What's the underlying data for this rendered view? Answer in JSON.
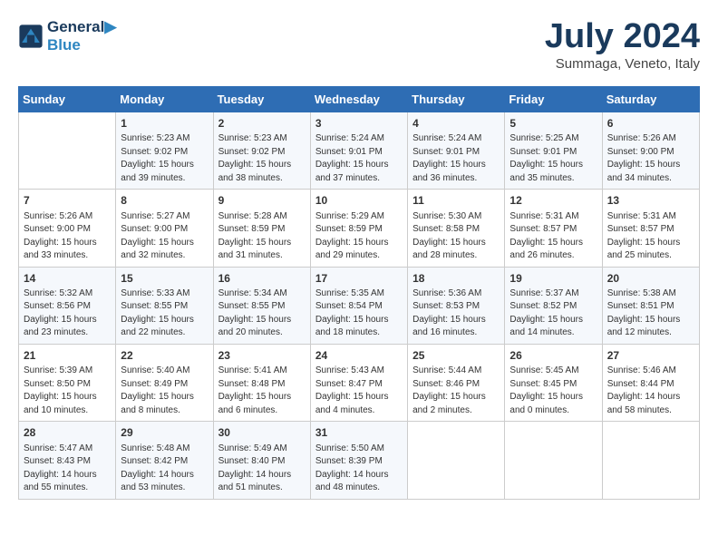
{
  "logo": {
    "line1": "General",
    "line2": "Blue"
  },
  "title": "July 2024",
  "subtitle": "Summaga, Veneto, Italy",
  "headers": [
    "Sunday",
    "Monday",
    "Tuesday",
    "Wednesday",
    "Thursday",
    "Friday",
    "Saturday"
  ],
  "rows": [
    [
      {
        "day": "",
        "info": ""
      },
      {
        "day": "1",
        "info": "Sunrise: 5:23 AM\nSunset: 9:02 PM\nDaylight: 15 hours\nand 39 minutes."
      },
      {
        "day": "2",
        "info": "Sunrise: 5:23 AM\nSunset: 9:02 PM\nDaylight: 15 hours\nand 38 minutes."
      },
      {
        "day": "3",
        "info": "Sunrise: 5:24 AM\nSunset: 9:01 PM\nDaylight: 15 hours\nand 37 minutes."
      },
      {
        "day": "4",
        "info": "Sunrise: 5:24 AM\nSunset: 9:01 PM\nDaylight: 15 hours\nand 36 minutes."
      },
      {
        "day": "5",
        "info": "Sunrise: 5:25 AM\nSunset: 9:01 PM\nDaylight: 15 hours\nand 35 minutes."
      },
      {
        "day": "6",
        "info": "Sunrise: 5:26 AM\nSunset: 9:00 PM\nDaylight: 15 hours\nand 34 minutes."
      }
    ],
    [
      {
        "day": "7",
        "info": "Sunrise: 5:26 AM\nSunset: 9:00 PM\nDaylight: 15 hours\nand 33 minutes."
      },
      {
        "day": "8",
        "info": "Sunrise: 5:27 AM\nSunset: 9:00 PM\nDaylight: 15 hours\nand 32 minutes."
      },
      {
        "day": "9",
        "info": "Sunrise: 5:28 AM\nSunset: 8:59 PM\nDaylight: 15 hours\nand 31 minutes."
      },
      {
        "day": "10",
        "info": "Sunrise: 5:29 AM\nSunset: 8:59 PM\nDaylight: 15 hours\nand 29 minutes."
      },
      {
        "day": "11",
        "info": "Sunrise: 5:30 AM\nSunset: 8:58 PM\nDaylight: 15 hours\nand 28 minutes."
      },
      {
        "day": "12",
        "info": "Sunrise: 5:31 AM\nSunset: 8:57 PM\nDaylight: 15 hours\nand 26 minutes."
      },
      {
        "day": "13",
        "info": "Sunrise: 5:31 AM\nSunset: 8:57 PM\nDaylight: 15 hours\nand 25 minutes."
      }
    ],
    [
      {
        "day": "14",
        "info": "Sunrise: 5:32 AM\nSunset: 8:56 PM\nDaylight: 15 hours\nand 23 minutes."
      },
      {
        "day": "15",
        "info": "Sunrise: 5:33 AM\nSunset: 8:55 PM\nDaylight: 15 hours\nand 22 minutes."
      },
      {
        "day": "16",
        "info": "Sunrise: 5:34 AM\nSunset: 8:55 PM\nDaylight: 15 hours\nand 20 minutes."
      },
      {
        "day": "17",
        "info": "Sunrise: 5:35 AM\nSunset: 8:54 PM\nDaylight: 15 hours\nand 18 minutes."
      },
      {
        "day": "18",
        "info": "Sunrise: 5:36 AM\nSunset: 8:53 PM\nDaylight: 15 hours\nand 16 minutes."
      },
      {
        "day": "19",
        "info": "Sunrise: 5:37 AM\nSunset: 8:52 PM\nDaylight: 15 hours\nand 14 minutes."
      },
      {
        "day": "20",
        "info": "Sunrise: 5:38 AM\nSunset: 8:51 PM\nDaylight: 15 hours\nand 12 minutes."
      }
    ],
    [
      {
        "day": "21",
        "info": "Sunrise: 5:39 AM\nSunset: 8:50 PM\nDaylight: 15 hours\nand 10 minutes."
      },
      {
        "day": "22",
        "info": "Sunrise: 5:40 AM\nSunset: 8:49 PM\nDaylight: 15 hours\nand 8 minutes."
      },
      {
        "day": "23",
        "info": "Sunrise: 5:41 AM\nSunset: 8:48 PM\nDaylight: 15 hours\nand 6 minutes."
      },
      {
        "day": "24",
        "info": "Sunrise: 5:43 AM\nSunset: 8:47 PM\nDaylight: 15 hours\nand 4 minutes."
      },
      {
        "day": "25",
        "info": "Sunrise: 5:44 AM\nSunset: 8:46 PM\nDaylight: 15 hours\nand 2 minutes."
      },
      {
        "day": "26",
        "info": "Sunrise: 5:45 AM\nSunset: 8:45 PM\nDaylight: 15 hours\nand 0 minutes."
      },
      {
        "day": "27",
        "info": "Sunrise: 5:46 AM\nSunset: 8:44 PM\nDaylight: 14 hours\nand 58 minutes."
      }
    ],
    [
      {
        "day": "28",
        "info": "Sunrise: 5:47 AM\nSunset: 8:43 PM\nDaylight: 14 hours\nand 55 minutes."
      },
      {
        "day": "29",
        "info": "Sunrise: 5:48 AM\nSunset: 8:42 PM\nDaylight: 14 hours\nand 53 minutes."
      },
      {
        "day": "30",
        "info": "Sunrise: 5:49 AM\nSunset: 8:40 PM\nDaylight: 14 hours\nand 51 minutes."
      },
      {
        "day": "31",
        "info": "Sunrise: 5:50 AM\nSunset: 8:39 PM\nDaylight: 14 hours\nand 48 minutes."
      },
      {
        "day": "",
        "info": ""
      },
      {
        "day": "",
        "info": ""
      },
      {
        "day": "",
        "info": ""
      }
    ]
  ]
}
